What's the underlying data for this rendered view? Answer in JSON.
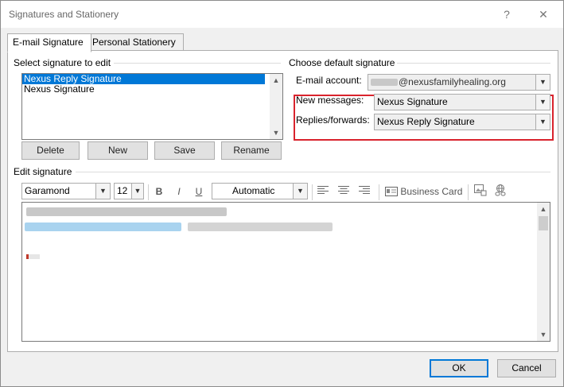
{
  "window": {
    "title": "Signatures and Stationery",
    "help": "?",
    "close": "✕"
  },
  "tabs": [
    {
      "label": "E-mail Signature",
      "active": true
    },
    {
      "label": "Personal Stationery",
      "active": false
    }
  ],
  "select_section": {
    "label": "Select signature to edit",
    "items": [
      "Nexus Reply Signature",
      "Nexus Signature"
    ],
    "selected_index": 0,
    "buttons": {
      "delete": "Delete",
      "new": "New",
      "save": "Save",
      "rename": "Rename"
    }
  },
  "default_section": {
    "label": "Choose default signature",
    "email_account": {
      "label": "E-mail account:",
      "value": "@nexusfamilyhealing.org"
    },
    "new_messages": {
      "label": "New messages:",
      "value": "Nexus Signature"
    },
    "replies": {
      "label": "Replies/forwards:",
      "value": "Nexus Reply Signature"
    },
    "highlight_color": "#d9232d"
  },
  "edit_section": {
    "label": "Edit signature",
    "font": "Garamond",
    "size": "12",
    "bold": "B",
    "italic": "I",
    "underline": "U",
    "color": "Automatic",
    "business_card": "Business Card"
  },
  "footer": {
    "ok": "OK",
    "cancel": "Cancel"
  },
  "colors": {
    "selection": "#0078d7",
    "accent": "#0078d7"
  }
}
